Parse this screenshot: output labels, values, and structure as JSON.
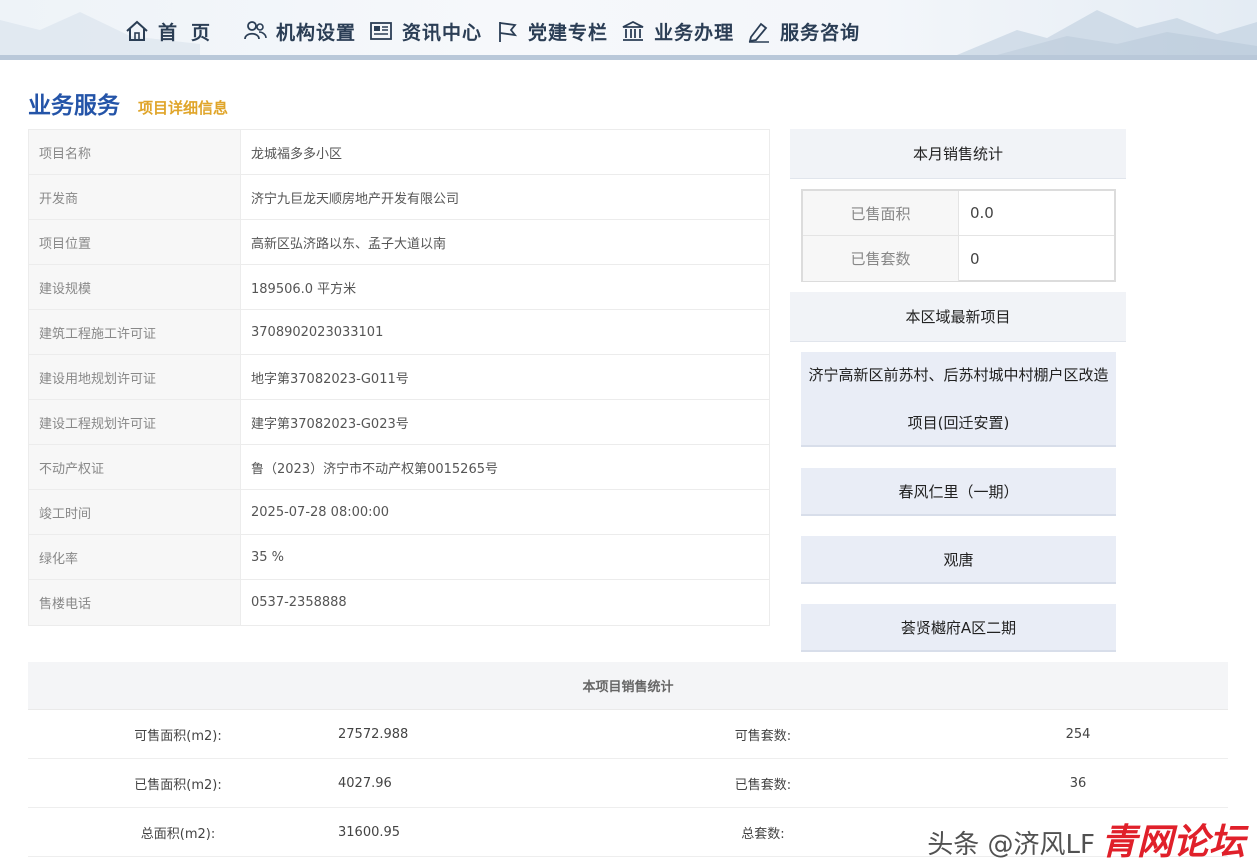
{
  "nav": {
    "items": [
      {
        "label": "首页",
        "icon": "home-icon"
      },
      {
        "label": "机构设置",
        "icon": "people-icon"
      },
      {
        "label": "资讯中心",
        "icon": "newspaper-icon"
      },
      {
        "label": "党建专栏",
        "icon": "flag-icon"
      },
      {
        "label": "业务办理",
        "icon": "bank-icon"
      },
      {
        "label": "服务咨询",
        "icon": "edit-icon"
      }
    ]
  },
  "section": {
    "title": "业务服务",
    "subtitle": "项目详细信息"
  },
  "detail": [
    {
      "label": "项目名称",
      "value": "龙城福多多小区"
    },
    {
      "label": "开发商",
      "value": "济宁九巨龙天顺房地产开发有限公司"
    },
    {
      "label": "项目位置",
      "value": "高新区弘济路以东、孟子大道以南"
    },
    {
      "label": "建设规模",
      "value": "189506.0 平方米"
    },
    {
      "label": "建筑工程施工许可证",
      "value": "3708902023033101"
    },
    {
      "label": "建设用地规划许可证",
      "value": "地字第37082023-G011号"
    },
    {
      "label": "建设工程规划许可证",
      "value": "建字第37082023-G023号"
    },
    {
      "label": "不动产权证",
      "value": "鲁（2023）济宁市不动产权第0015265号"
    },
    {
      "label": "竣工时间",
      "value": "2025-07-28 08:00:00"
    },
    {
      "label": "绿化率",
      "value": "35 %"
    },
    {
      "label": "售楼电话",
      "value": "0537-2358888"
    }
  ],
  "monthly": {
    "title": "本月销售统计",
    "rows": [
      {
        "label": "已售面积",
        "value": "0.0"
      },
      {
        "label": "已售套数",
        "value": "0"
      }
    ]
  },
  "latest": {
    "title": "本区域最新项目",
    "projects": [
      "济宁高新区前苏村、后苏村城中村棚户区改造项目(回迁安置)",
      "春风仁里（一期）",
      "观唐",
      "荟贤樾府A区二期"
    ]
  },
  "project_stats": {
    "title": "本项目销售统计",
    "rows": [
      {
        "label1": "可售面积(m2):",
        "value1": "27572.988",
        "label2": "可售套数:",
        "value2": "254"
      },
      {
        "label1": "已售面积(m2):",
        "value1": "4027.96",
        "label2": "已售套数:",
        "value2": "36"
      },
      {
        "label1": "总面积(m2):",
        "value1": "31600.95",
        "label2": "总套数:",
        "value2": ""
      }
    ]
  },
  "watermark": {
    "line1": "头条 @济风LF",
    "line2": "青网论坛"
  },
  "colors": {
    "title_blue": "#2454a8",
    "subtitle_gold": "#e0a52a",
    "nav_text": "#2b3e55"
  }
}
